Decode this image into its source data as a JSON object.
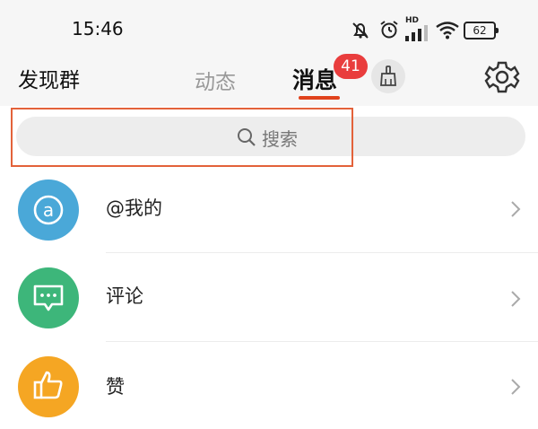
{
  "status_bar": {
    "time": "15:46",
    "network_label": "HD",
    "battery": "62"
  },
  "nav": {
    "left_label": "发现群",
    "tabs": [
      {
        "label": "动态",
        "active": false
      },
      {
        "label": "消息",
        "active": true
      }
    ],
    "badge_count": "41",
    "clean_icon": "broom-icon",
    "settings_icon": "gear-icon",
    "accent_color": "#e0421c"
  },
  "search": {
    "placeholder": "搜索",
    "icon": "search-icon"
  },
  "messages": [
    {
      "label": "@我的",
      "icon": "at-icon",
      "color": "#4aa8d8"
    },
    {
      "label": "评论",
      "icon": "comment-icon",
      "color": "#3db67a"
    },
    {
      "label": "赞",
      "icon": "thumbs-up-icon",
      "color": "#f5a623"
    }
  ]
}
